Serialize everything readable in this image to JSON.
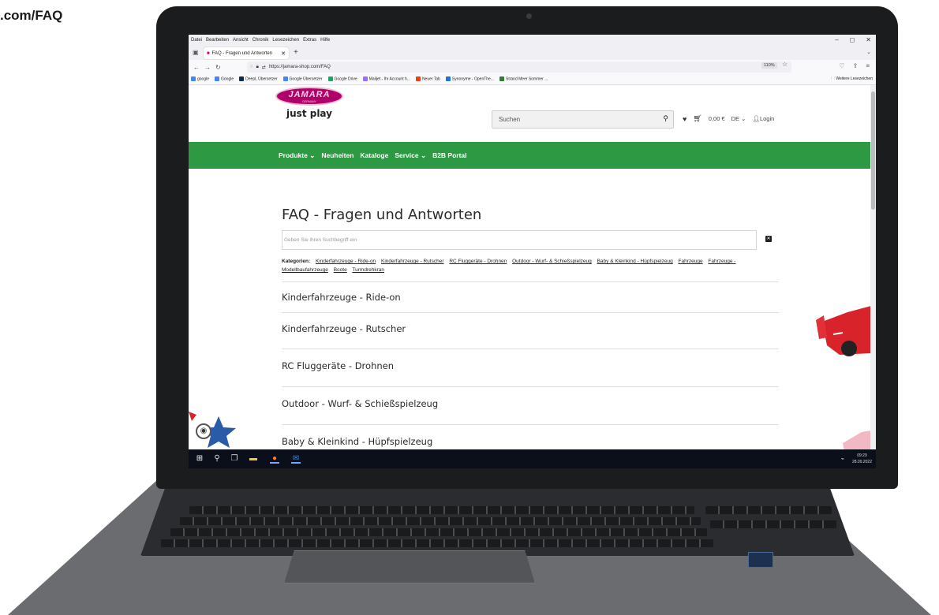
{
  "corner_url": ".com/FAQ",
  "browser": {
    "menu": [
      "Datei",
      "Bearbeiten",
      "Ansicht",
      "Chronik",
      "Lesezeichen",
      "Extras",
      "Hilfe"
    ],
    "window_controls": {
      "minimize": "–",
      "maximize": "◻",
      "close": "✕"
    },
    "tab_title": "FAQ - Fragen und Antworten",
    "tab_close": "✕",
    "new_tab": "+",
    "url": "https://jamara-shop.com/FAQ",
    "zoom": "110%",
    "bookmarks": [
      {
        "label": "google",
        "color": "#4285f4"
      },
      {
        "label": "Google",
        "color": "#4285f4"
      },
      {
        "label": "DeepL Übersetzer",
        "color": "#0f2b46"
      },
      {
        "label": "Google Übersetzer",
        "color": "#4285f4"
      },
      {
        "label": "Google Drive",
        "color": "#1fa463"
      },
      {
        "label": "Mailjet - Ihr Account h...",
        "color": "#9c6cff"
      },
      {
        "label": "Neuer Tab",
        "color": "#e8430a"
      },
      {
        "label": "Synonyme - OpenThe...",
        "color": "#1976d2"
      },
      {
        "label": "Strand Meer Sommer ...",
        "color": "#2e7d32"
      }
    ],
    "more_bookmarks": "Weitere Lesezeichen"
  },
  "site": {
    "logo_text": "JAMARA",
    "logo_sub": "GERMANY",
    "logo_tagline": "just play",
    "search_placeholder": "Suchen",
    "cart_total": "0,00 €",
    "language": "DE",
    "login": "Login",
    "nav": [
      "Produkte ⌄",
      "Neuheiten",
      "Kataloge",
      "Service ⌄",
      "B2B Portal"
    ],
    "brand_green": "#2d9a43",
    "brand_magenta": "#b1006a"
  },
  "faq": {
    "title": "FAQ - Fragen und Antworten",
    "search_placeholder": "Geben Sie ihren Suchbegriff ein",
    "clear": "✕",
    "categories_label": "Kategorien:",
    "categories": [
      "Kinderfahrzeuge - Ride-on",
      "Kinderfahrzeuge - Rutscher",
      "RC Fluggeräte - Drohnen",
      "Outdoor - Wurf- & Schießspielzeug",
      "Baby & Kleinkind - Hüpfspielzeug",
      "Fahrzeuge",
      "Fahrzeuge - Modellbaufahrzeuge",
      "Boote",
      "Turmdrehkran"
    ],
    "sections": [
      "Kinderfahrzeuge - Ride-on",
      "Kinderfahrzeuge - Rutscher",
      "RC Fluggeräte - Drohnen",
      "Outdoor - Wurf- & Schießspielzeug",
      "Baby & Kleinkind - Hüpfspielzeug"
    ]
  },
  "taskbar": {
    "time": "09:29",
    "date": "28.09.2022",
    "apps": [
      "windows-start-icon",
      "search-icon",
      "task-view-icon",
      "file-explorer-icon",
      "firefox-icon",
      "outlook-icon"
    ]
  }
}
